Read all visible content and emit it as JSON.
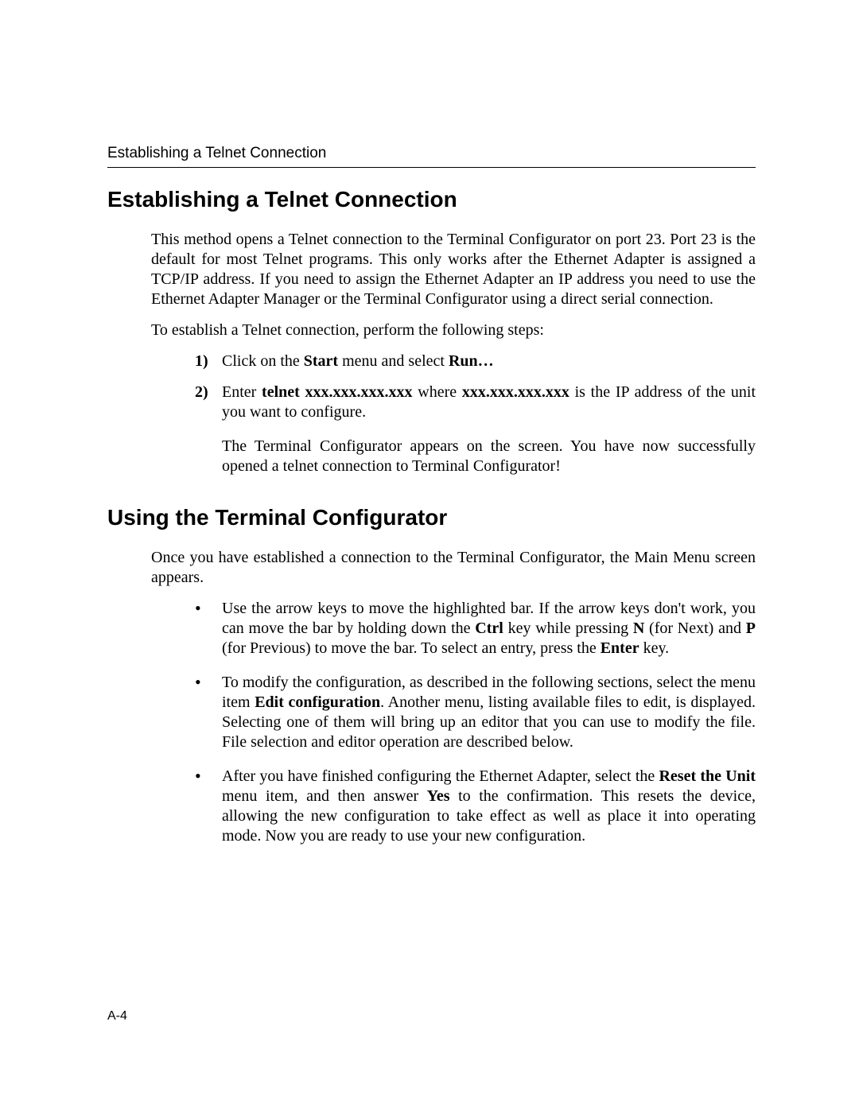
{
  "header": {
    "running_title": "Establishing a Telnet Connection"
  },
  "section1": {
    "heading": "Establishing a Telnet Connection",
    "intro": "This method opens a Telnet connection to the Terminal Configurator on port 23. Port 23 is the default for most Telnet programs. This only works after the Ethernet Adapter is assigned a TCP/IP address. If you need to assign the Ethernet Adapter an IP address you need to use the Ethernet Adapter Manager or the Terminal Configurator using a direct serial connection.",
    "lead_in": "To establish a Telnet connection, perform the following steps:",
    "steps": [
      {
        "num": "1)",
        "pre": "Click on the ",
        "b1": "Start",
        "mid": " menu and select ",
        "b2": "Run…",
        "post": ""
      },
      {
        "num": "2)",
        "pre": "Enter ",
        "b1": "telnet xxx.xxx.xxx.xxx",
        "mid": " where ",
        "b2": "xxx.xxx.xxx.xxx",
        "post": " is the IP address of the unit you want to configure."
      }
    ],
    "result": "The Terminal Configurator appears on the screen. You have now successfully opened a telnet connection to Terminal Configurator!"
  },
  "section2": {
    "heading": "Using the Terminal Configurator",
    "intro": "Once you have established a connection to the Terminal Configurator, the Main Menu screen appears.",
    "bullets": [
      {
        "t0": "Use the arrow keys to move the highlighted bar. If the arrow keys don't work, you can move the bar by holding down the ",
        "b0": "Ctrl",
        "t1": " key while pressing ",
        "b1": "N",
        "t2": " (for Next) and ",
        "b2": "P",
        "t3": " (for Previous) to move the bar. To select an entry, press the ",
        "b3": "Enter",
        "t4": " key."
      },
      {
        "t0": "To modify the configuration, as described in the following sections, select the menu item ",
        "b0": "Edit configuration",
        "t1": ". Another menu, listing available files to edit, is displayed. Selecting one of them will bring up an editor that you can use to modify the file. File selection and editor operation are described below.",
        "b1": "",
        "t2": "",
        "b2": "",
        "t3": "",
        "b3": "",
        "t4": ""
      },
      {
        "t0": "After you have finished configuring the Ethernet Adapter, select the ",
        "b0": "Reset the Unit",
        "t1": " menu item, and then answer ",
        "b1": "Yes",
        "t2": " to the confirmation. This resets the device, allowing the new configuration to take effect as well as place it into operating mode. Now you are ready to use your new configuration.",
        "b2": "",
        "t3": "",
        "b3": "",
        "t4": ""
      }
    ]
  },
  "footer": {
    "page_number": "A-4"
  }
}
